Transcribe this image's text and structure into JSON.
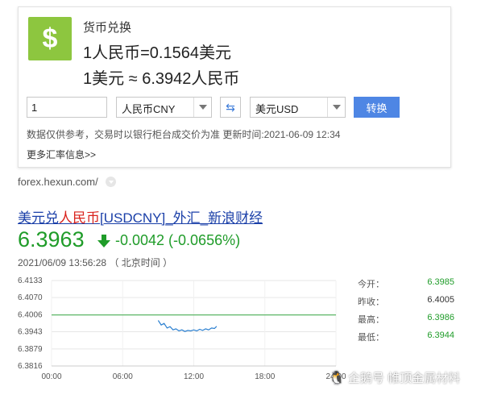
{
  "converter": {
    "title": "货币兑换",
    "rate_line_1": "1人民币=0.1564美元",
    "rate_line_2": "1美元 ≈ 6.3942人民币",
    "amount_value": "1",
    "from_currency": "人民币CNY",
    "to_currency": "美元USD",
    "swap_icon": "⇆",
    "convert_label": "转换",
    "disclaimer": "数据仅供参考，交易时以银行柜台成交价为准 更新时间:2021-06-09 12:34",
    "more_link": "更多汇率信息>>",
    "icon_glyph": "$"
  },
  "source": {
    "url": "forex.hexun.com/"
  },
  "quote": {
    "title_prefix": "美元兑",
    "title_highlight": "人民币",
    "title_suffix": "[USDCNY]_外汇_新浪财经",
    "price": "6.3963",
    "change": "-0.0042 (-0.0656%)",
    "timestamp": "2021/06/09 13:56:28 （ 北京时间 ）"
  },
  "stats": [
    {
      "label": "今开：",
      "value": "6.3985"
    },
    {
      "label": "昨收：",
      "value": "6.4005"
    },
    {
      "label": "最高：",
      "value": "6.3986"
    },
    {
      "label": "最低：",
      "value": "6.3944"
    }
  ],
  "chart_data": {
    "type": "line",
    "y_ticks": [
      "6.4133",
      "6.4070",
      "6.4006",
      "6.3943",
      "6.3879",
      "6.3816"
    ],
    "x_ticks": [
      "00:00",
      "06:00",
      "12:00",
      "18:00",
      "24:00"
    ],
    "ylim": [
      6.3816,
      6.4133
    ],
    "xlim": [
      0,
      24
    ],
    "reference_value": 6.4005,
    "series": [
      {
        "x": [
          9.0,
          9.25,
          9.5,
          9.75,
          10.0,
          10.25,
          10.5,
          10.75,
          11.0,
          11.25,
          11.5,
          11.75,
          12.0,
          12.25,
          12.5,
          12.75,
          13.0,
          13.25,
          13.5,
          13.75,
          13.93
        ],
        "y": [
          6.3985,
          6.3968,
          6.3974,
          6.3957,
          6.3962,
          6.395,
          6.3954,
          6.3946,
          6.395,
          6.3944,
          6.3948,
          6.3946,
          6.395,
          6.3946,
          6.3952,
          6.3948,
          6.3954,
          6.395,
          6.3957,
          6.3955,
          6.3963
        ]
      }
    ],
    "colors": {
      "line": "#2a7fd0",
      "reference": "#39a845"
    }
  },
  "watermark": {
    "logo": "🐧",
    "text": "企鹅号 帷顶金属材料"
  }
}
